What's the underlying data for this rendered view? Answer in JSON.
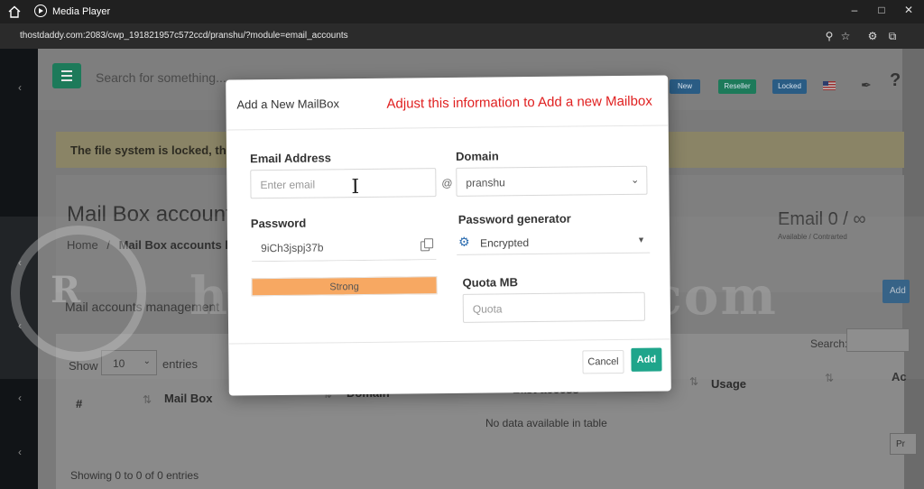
{
  "window": {
    "title": "Media Player"
  },
  "address_bar": {
    "url": "thostdaddy.com:2083/cwp_191821957c572ccd/pranshu/?module=email_accounts"
  },
  "topnav": {
    "search_placeholder": "Search for something...",
    "pills": [
      {
        "label": "New",
        "color": "#2a5c84"
      },
      {
        "label": "Reseller",
        "color": "#1d7a5a"
      },
      {
        "label": "Locked",
        "color": "#2a5c84"
      }
    ]
  },
  "alert": {
    "text": "The file system is locked, this"
  },
  "page_header": {
    "title": "Mail Box accounts",
    "breadcrumb_home": "Home",
    "breadcrumb_sep": "/",
    "breadcrumb_current": "Mail Box accounts lis",
    "email_count": "Email 0 / ∞",
    "email_count_sub": "Available / Contrarted",
    "add_button_partial": "Add"
  },
  "management": {
    "title": "Mail accounts management"
  },
  "table": {
    "show_label": "Show",
    "show_value": "10",
    "entries_label": "entries",
    "search_label": "Search:",
    "columns": [
      "#",
      "Mail Box",
      "Domain",
      "Last access",
      "Usage",
      "Ac"
    ],
    "empty_text": "No data available in table",
    "footer_text": "Showing 0 to 0 of 0 entries",
    "pager_partial": "Pr"
  },
  "watermark": {
    "text": "honestoreview.com",
    "logo_text": "R"
  },
  "modal": {
    "title": "Add a New MailBox",
    "annotation": "Adjust this information to Add a new Mailbox",
    "email_label": "Email Address",
    "email_placeholder": "Enter email",
    "at_sign": "@",
    "domain_label": "Domain",
    "domain_value": "pranshu",
    "password_label": "Password",
    "password_value": "9iCh3jspj37b",
    "password_strength": "Strong",
    "password_strength_level": "Strong",
    "generator_label": "Password generator",
    "generator_value": "Encrypted",
    "quota_label": "Quota MB",
    "quota_placeholder": "Quota",
    "cancel_label": "Cancel",
    "add_label": "Add",
    "accent_color": "#1fa58b",
    "annotation_color": "#e02020"
  }
}
